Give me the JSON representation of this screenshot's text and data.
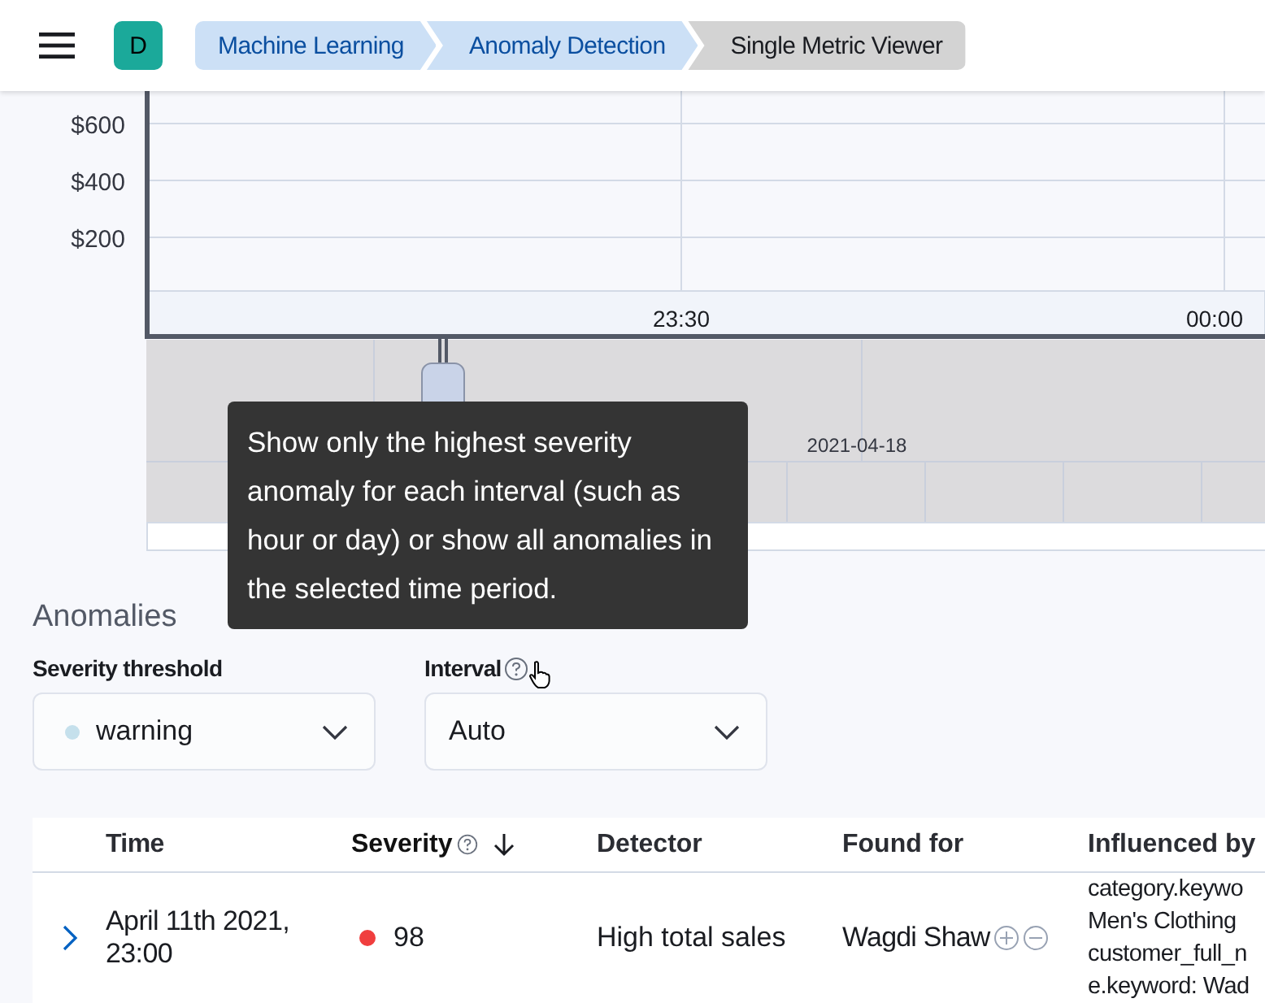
{
  "header": {
    "avatar": "D",
    "breadcrumbs": [
      {
        "label": "Machine Learning",
        "current": false
      },
      {
        "label": "Anomaly Detection",
        "current": false
      },
      {
        "label": "Single Metric Viewer",
        "current": true
      }
    ]
  },
  "chart": {
    "y_labels": [
      "$600",
      "$400",
      "$200"
    ],
    "x_labels": [
      "23:30",
      "00:00"
    ],
    "overview_label": "2021-04-18"
  },
  "tooltip": "Show only the highest severity anomaly for each interval (such as hour or day) or show all anomalies in the selected time period.",
  "anomalies": {
    "title": "Anomalies",
    "severity_threshold": {
      "label": "Severity threshold",
      "value": "warning",
      "color": "#c5e0ec"
    },
    "interval": {
      "label": "Interval",
      "value": "Auto"
    }
  },
  "table": {
    "columns": [
      {
        "label": "Time",
        "help": false,
        "sorted": false
      },
      {
        "label": "Severity",
        "help": true,
        "sorted": true
      },
      {
        "label": "Detector",
        "help": false,
        "sorted": false
      },
      {
        "label": "Found for",
        "help": false,
        "sorted": false
      },
      {
        "label": "Influenced by",
        "help": false,
        "sorted": false
      }
    ],
    "rows": [
      {
        "expanded": false,
        "time": "April 11th 2021, 23:00",
        "severity": "98",
        "color": "#f03e3e",
        "detector": "High total sales",
        "found_for": "Wagdi Shaw",
        "influenced_by": [
          "category.keywo",
          "Men's Clothing",
          "customer_full_n",
          "e.keyword: Wad"
        ]
      }
    ]
  }
}
